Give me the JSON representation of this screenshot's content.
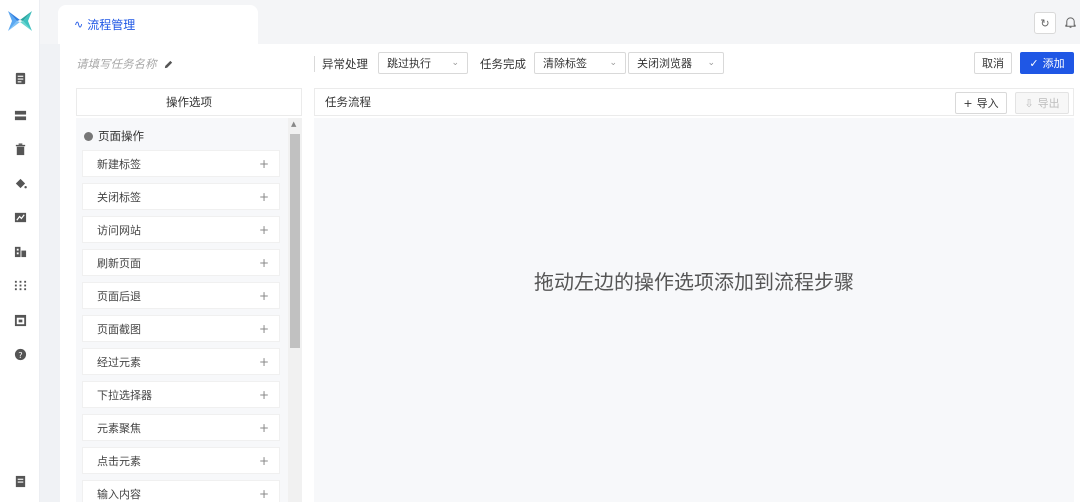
{
  "tab": {
    "title": "流程管理"
  },
  "task": {
    "name_placeholder": "请填写任务名称"
  },
  "toolbar": {
    "exception_label": "异常处理",
    "exception_value": "跳过执行",
    "complete_label": "任务完成",
    "complete_value1": "清除标签",
    "complete_value2": "关闭浏览器",
    "cancel_label": "取消",
    "add_label": "添加"
  },
  "ops": {
    "header": "操作选项",
    "group": "页面操作",
    "items": [
      "新建标签",
      "关闭标签",
      "访问网站",
      "刷新页面",
      "页面后退",
      "页面截图",
      "经过元素",
      "下拉选择器",
      "元素聚焦",
      "点击元素",
      "输入内容"
    ]
  },
  "flow": {
    "header": "任务流程",
    "import_label": "导入",
    "export_label": "导出",
    "empty_hint": "拖动左边的操作选项添加到流程步骤"
  },
  "colors": {
    "primary": "#1f57e5",
    "logo_a": "#4aa3f0",
    "logo_b": "#3fc2c0"
  }
}
